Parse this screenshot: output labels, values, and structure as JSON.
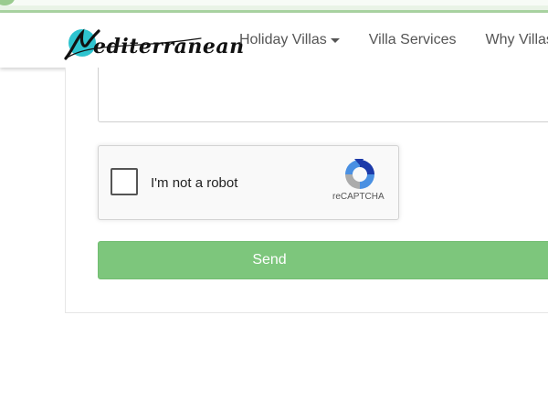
{
  "brand": {
    "name": "mediterranean",
    "wordmark": "editerranean"
  },
  "nav": {
    "items": [
      {
        "label": "Holiday Villas",
        "has_dropdown": true
      },
      {
        "label": "Villa Services",
        "has_dropdown": false
      },
      {
        "label": "Why Villas I",
        "has_dropdown": false
      }
    ]
  },
  "form": {
    "recaptcha": {
      "label": "I'm not a robot",
      "brand": "reCAPTCHA",
      "checked": false
    },
    "send_label": "Send"
  },
  "colors": {
    "accent_green": "#7dc67c",
    "logo_teal": "#2ec4cf"
  }
}
